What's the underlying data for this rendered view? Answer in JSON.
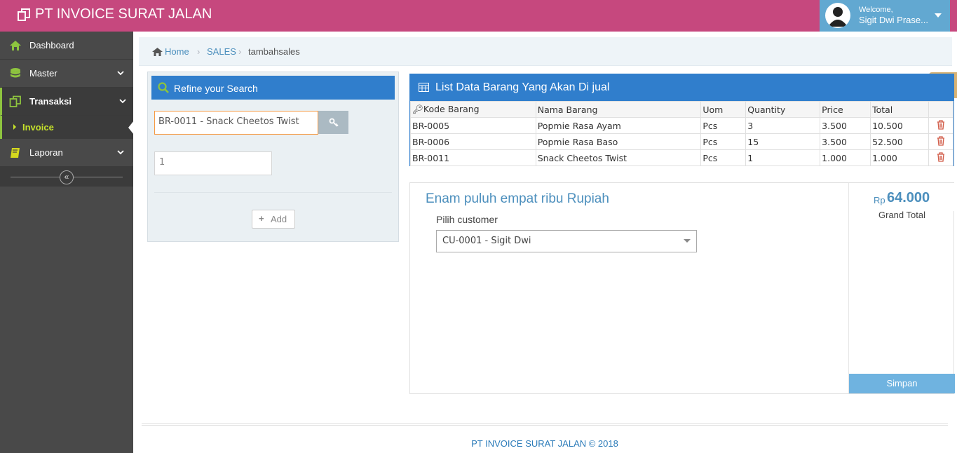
{
  "app": {
    "title": "PT INVOICE SURAT JALAN"
  },
  "user": {
    "welcome": "Welcome,",
    "name": "Sigit Dwi Prase..."
  },
  "sidebar": {
    "items": [
      {
        "label": "Dashboard",
        "icon": "home-icon"
      },
      {
        "label": "Master",
        "icon": "database-icon"
      },
      {
        "label": "Transaksi",
        "icon": "copy-icon"
      },
      {
        "label": "Invoice",
        "icon": "caret-right-icon"
      },
      {
        "label": "Laporan",
        "icon": "book-icon"
      }
    ],
    "collapse_symbol": "«"
  },
  "breadcrumb": {
    "home": "Home",
    "section": "SALES",
    "current": "tambahsales"
  },
  "search": {
    "title": "Refine your Search",
    "item_value": "BR-0011 - Snack Cheetos Twist",
    "qty_value": "1",
    "add_label": "Add"
  },
  "list": {
    "title": "List Data Barang Yang Akan Di jual",
    "columns": [
      "Kode Barang",
      "Nama Barang",
      "Uom",
      "Quantity",
      "Price",
      "Total"
    ],
    "rows": [
      [
        "BR-0005",
        "Popmie Rasa Ayam",
        "Pcs",
        "3",
        "3.500",
        "10.500"
      ],
      [
        "BR-0006",
        "Popmie Rasa Baso",
        "Pcs",
        "15",
        "3.500",
        "52.500"
      ],
      [
        "BR-0011",
        "Snack Cheetos Twist",
        "Pcs",
        "1",
        "1.000",
        "1.000"
      ]
    ]
  },
  "summary": {
    "terbilang": "Enam puluh empat ribu Rupiah",
    "customer_label": "Pilih customer",
    "customer_value": "CU-0001 - Sigit Dwi",
    "currency": "Rp",
    "grand_total": "64.000",
    "grand_total_label": "Grand Total",
    "save_label": "Simpan"
  },
  "footer": {
    "text": "PT INVOICE SURAT JALAN © 2018"
  },
  "colors": {
    "navbar": "#c6487e",
    "user_box": "#62a8d1",
    "sidebar": "#494949",
    "accent": "#307ecc",
    "active_green": "#8ec43f"
  }
}
